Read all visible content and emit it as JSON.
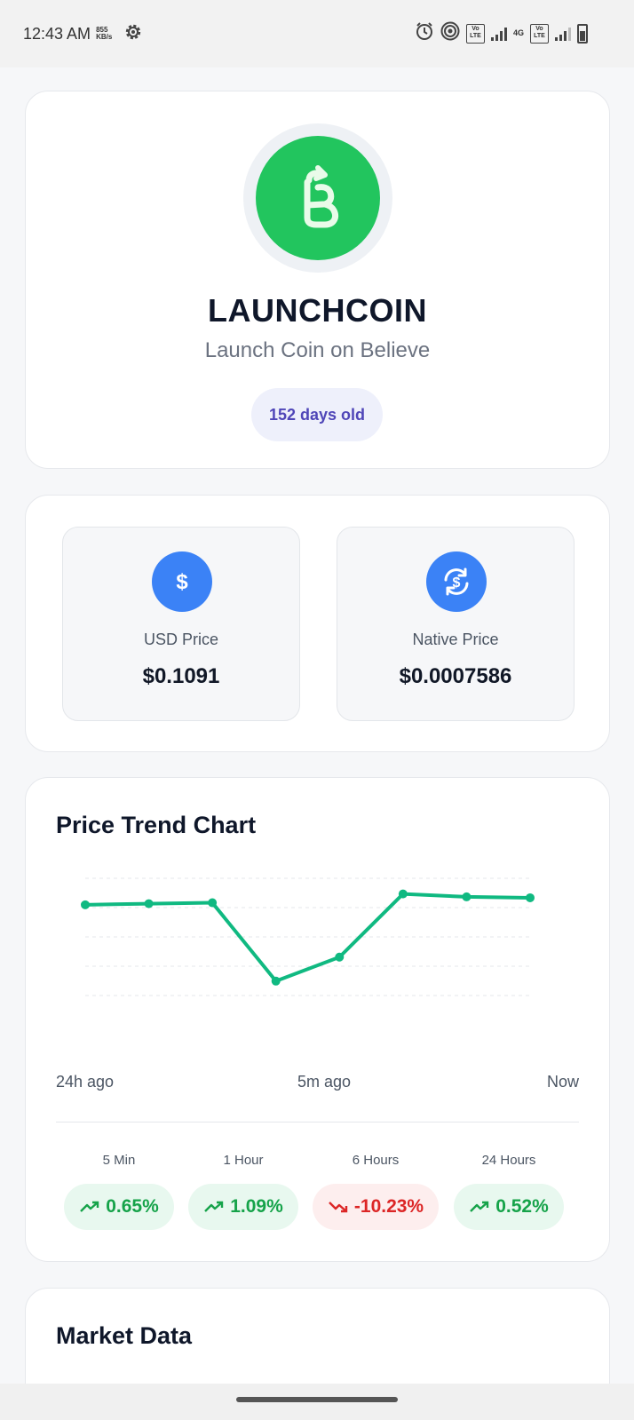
{
  "status_bar": {
    "time": "12:43 AM",
    "net_speed_value": "855",
    "net_speed_unit": "KB/s",
    "volte_1": "Vo LTE",
    "network_type": "4G",
    "volte_2": "Vo LTE",
    "icons": [
      "gear-icon",
      "alarm-icon",
      "hotspot-icon",
      "signal-icon",
      "battery-icon"
    ]
  },
  "token": {
    "symbol": "LAUNCHCOIN",
    "name": "Launch Coin on Believe",
    "age": "152 days old",
    "logo_color": "#22c55e"
  },
  "prices": {
    "usd": {
      "label": "USD Price",
      "value": "$0.1091",
      "icon": "dollar-icon"
    },
    "native": {
      "label": "Native Price",
      "value": "$0.0007586",
      "icon": "currency-exchange-icon"
    },
    "accent": "#3b82f6"
  },
  "chart_section": {
    "title": "Price Trend Chart",
    "x_labels": [
      "24h ago",
      "5m ago",
      "Now"
    ]
  },
  "chart_data": {
    "type": "line",
    "title": "Price Trend Chart",
    "x": [
      "24h ago",
      "",
      "",
      "",
      "",
      "",
      "",
      "Now"
    ],
    "values": [
      0.0879,
      0.0884,
      0.0888,
      0.0542,
      0.0648,
      0.0927,
      0.0914,
      0.091
    ],
    "ylim": [
      0.04,
      0.1
    ],
    "grid": true,
    "line_color": "#10b981"
  },
  "changes": [
    {
      "label": "5 Min",
      "value": "0.65%",
      "direction": "up"
    },
    {
      "label": "1 Hour",
      "value": "1.09%",
      "direction": "up"
    },
    {
      "label": "6 Hours",
      "value": "-10.23%",
      "direction": "down"
    },
    {
      "label": "24 Hours",
      "value": "0.52%",
      "direction": "up"
    }
  ],
  "colors": {
    "up": "#16a34a",
    "down": "#dc2626"
  },
  "market": {
    "title": "Market Data"
  }
}
